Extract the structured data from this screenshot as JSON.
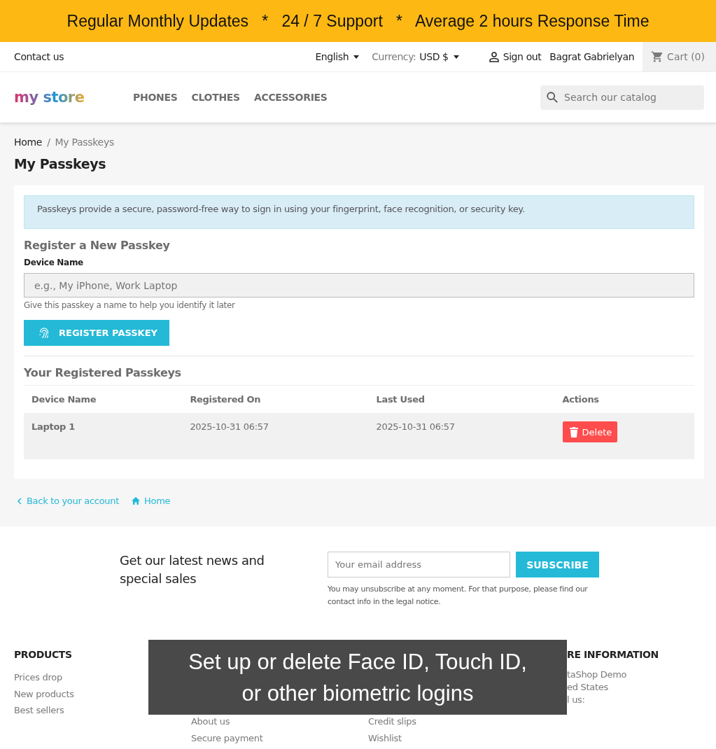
{
  "banner": {
    "text": "Regular Monthly Updates   *   24 / 7 Support   *   Average 2 hours Response Time"
  },
  "top_nav": {
    "contact": "Contact us",
    "language": "English",
    "currency_label": "Currency:",
    "currency": "USD $",
    "sign_out": "Sign out",
    "user": "Bagrat Gabrielyan",
    "cart": "Cart",
    "cart_count": "(0)"
  },
  "header": {
    "logo": "my store",
    "menu": [
      "PHONES",
      "CLOTHES",
      "ACCESSORIES"
    ],
    "search": {
      "placeholder": "Search our catalog"
    }
  },
  "breadcrumb": {
    "home": "Home",
    "separator": "/",
    "current": "My Passkeys"
  },
  "page_title": "My Passkeys",
  "info": "Passkeys provide a secure, password-free way to sign in using your fingerprint, face recognition, or security key.",
  "register": {
    "heading": "Register a New Passkey",
    "label": "Device Name",
    "placeholder": "e.g., My iPhone, Work Laptop",
    "help": "Give this passkey a name to help you identify it later",
    "button": "REGISTER PASSKEY"
  },
  "registered": {
    "heading": "Your Registered Passkeys",
    "columns": [
      "Device Name",
      "Registered On",
      "Last Used",
      "Actions"
    ],
    "rows": [
      {
        "device": "Laptop 1",
        "registered_on": "2025-10-31 06:57",
        "last_used": "2025-10-31 06:57",
        "action": "Delete"
      }
    ]
  },
  "links": {
    "back": "Back to your account",
    "home": "Home"
  },
  "newsletter": {
    "title": "Get our latest news and special sales",
    "placeholder": "Your email address",
    "button": "SUBSCRIBE",
    "note": "You may unsubscribe at any moment. For that purpose, please find our contact info in the legal notice."
  },
  "footer": {
    "columns": [
      {
        "kind": "links",
        "heading": "PRODUCTS",
        "items": [
          "Prices drop",
          "New products",
          "Best sellers"
        ]
      },
      {
        "kind": "links",
        "items": [
          "About us",
          "Secure payment"
        ]
      },
      {
        "kind": "links",
        "items": [
          "Credit slips",
          "Wishlist"
        ]
      },
      {
        "kind": "address",
        "heading": "RE INFORMATION",
        "items": [
          "taShop Demo",
          "ed States",
          "l us:"
        ]
      }
    ]
  },
  "overlay": {
    "text": "Set up or delete Face ID, Touch ID, or other biometric logins"
  }
}
